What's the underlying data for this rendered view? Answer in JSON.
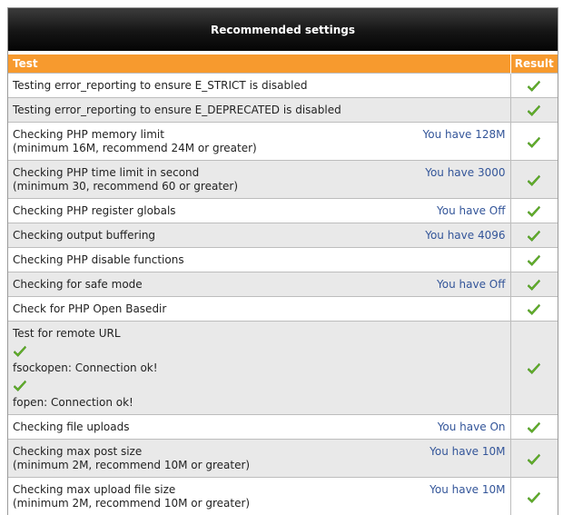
{
  "header": {
    "title": "Recommended settings"
  },
  "columns": {
    "test": "Test",
    "result": "Result"
  },
  "colors": {
    "header_bar": "#f79a2e",
    "check": "#6ab62c",
    "info_text": "#335599"
  },
  "result_icon": "green-checkmark-icon",
  "rows": [
    {
      "label": "Testing error_reporting to ensure E_STRICT is disabled",
      "info": "",
      "result": "pass"
    },
    {
      "label": "Testing error_reporting to ensure E_DEPRECATED is disabled",
      "info": "",
      "result": "pass"
    },
    {
      "label": "Checking PHP memory limit\n(minimum 16M, recommend 24M or greater)",
      "info": "You have 128M",
      "result": "pass"
    },
    {
      "label": "Checking PHP time limit in second\n(minimum 30, recommend 60 or greater)",
      "info": "You have 3000",
      "result": "pass"
    },
    {
      "label": "Checking PHP register globals",
      "info": "You have Off",
      "result": "pass"
    },
    {
      "label": "Checking output buffering",
      "info": "You have 4096",
      "result": "pass"
    },
    {
      "label": "Checking PHP disable functions",
      "info": "",
      "result": "pass"
    },
    {
      "label": "Checking for safe mode",
      "info": "You have Off",
      "result": "pass"
    },
    {
      "label": "Check for PHP Open Basedir",
      "info": "",
      "result": "pass"
    },
    {
      "label": "Test for remote URL",
      "info": "",
      "result": "pass",
      "subs": [
        {
          "text": "fsockopen: Connection ok!"
        },
        {
          "text": "fopen: Connection ok!"
        }
      ]
    },
    {
      "label": "Checking file uploads",
      "info": "You have On",
      "result": "pass"
    },
    {
      "label": "Checking max post size\n(minimum 2M, recommend 10M or greater)",
      "info": "You have 10M",
      "result": "pass"
    },
    {
      "label": "Checking max upload file size\n(minimum 2M, recommend 10M or greater)",
      "info": "You have 10M",
      "result": "pass"
    }
  ]
}
